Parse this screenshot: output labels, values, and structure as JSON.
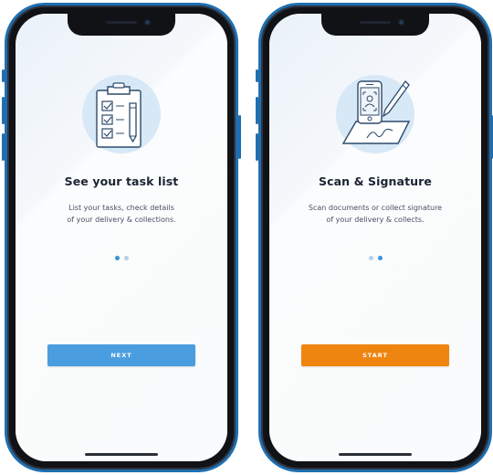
{
  "colors": {
    "frame": "#1f6fb0",
    "next_button": "#4a9ee0",
    "start_button": "#ef8511",
    "dot_active": "#3a93d6",
    "dot_inactive": "#b7d0e6",
    "illustration_circle": "#d7e8f6",
    "illustration_stroke": "#2d4a6a"
  },
  "screens": [
    {
      "illustration_icon": "clipboard-checklist-icon",
      "title": "See your task list",
      "description_line1": "List your tasks, check details",
      "description_line2": "of your delivery & collections.",
      "pagination_active_index": 0,
      "pagination_count": 2,
      "button_label": "NEXT"
    },
    {
      "illustration_icon": "scan-signature-icon",
      "title": "Scan & Signature",
      "description_line1": "Scan documents or collect signature",
      "description_line2": "of your delivery & collects.",
      "pagination_active_index": 1,
      "pagination_count": 2,
      "button_label": "START"
    }
  ]
}
